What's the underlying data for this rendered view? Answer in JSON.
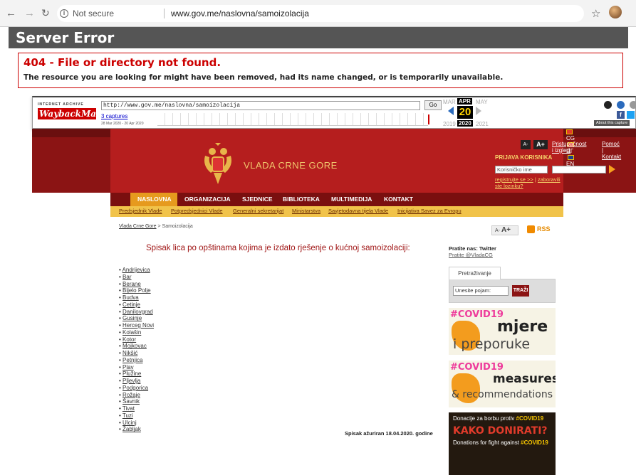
{
  "browser": {
    "security_label": "Not secure",
    "url": "www.gov.me/naslovna/samoizolacija"
  },
  "server_error": {
    "title": "Server Error",
    "heading": "404 - File or directory not found.",
    "message": "The resource you are looking for might have been removed, had its name changed, or is temporarily unavailable."
  },
  "wayback": {
    "logo_top": "INTERNET ARCHIVE",
    "logo_main": "WaybackMachine",
    "url": "http://www.gov.me/naslovna/samoizolacija",
    "go_label": "Go",
    "captures": "3 captures",
    "range": "28 Mar 2020 - 20 Apr 2020",
    "month_prev": "MAR",
    "month_current": "APR",
    "month_next": "MAY",
    "day": "20",
    "year_prev": "2019",
    "year_current": "2020",
    "year_next": "2021",
    "about": "About this capture"
  },
  "site": {
    "languages": [
      "CG",
      "ЦГ",
      "EN"
    ],
    "title": "VLADA CRNE GORE",
    "size_small": "A-",
    "size_large": "A+",
    "header_links": [
      "Pristupačnost i izgled",
      "Pomoć | Kontakt"
    ],
    "login": {
      "label": "PRIJAVA KORISNIKA",
      "username_placeholder": "Korisničko ime",
      "register": "registrujte se >>",
      "separator": "|",
      "forgot": "zaboravili ste lozinku?"
    },
    "nav": [
      "NASLOVNA",
      "ORGANIZACIJA",
      "SJEDNICE",
      "BIBLIOTEKA",
      "MULTIMEDIJA",
      "KONTAKT"
    ],
    "subnav": [
      "Predsjednik Vlade",
      "Potpredsjednici Vlade",
      "Generalni sekretarijat",
      "Ministarstva",
      "Savjetodavna tijela Vlade",
      "Inicijativa Savez za Evropu"
    ]
  },
  "content": {
    "breadcrumb_link": "Vlada Crne Gore",
    "breadcrumb_sep": ">",
    "breadcrumb_current": "Samoizolacija",
    "text_small": "A-",
    "text_large": "A+",
    "rss": "RSS",
    "heading": "Spisak lica po opštinama kojima je izdato rješenje o kućnoj samoizolaciji:",
    "towns": [
      "Andrijevica",
      "Bar",
      "Berane",
      "Bijelo Polje",
      "Budva",
      "Cetinje",
      "Danilovgrad",
      "Gusinje",
      "Herceg Novi",
      "Kolašin",
      "Kotor",
      "Mojkovac",
      "Nikšić",
      "Petnjica",
      "Plav",
      "Plužine",
      "Pljevlja",
      "Podgorica",
      "Rožaje",
      "Šavnik",
      "Tivat",
      "Tuzi",
      "Ulcinj",
      "Žabljak"
    ],
    "updated": "Spisak ažuriran 18.04.2020. godine"
  },
  "sidebar": {
    "follow": "Pratite nas: Twitter",
    "follow_handle": "Pratite @VladaCG",
    "search_tab": "Pretraživanje",
    "search_placeholder": "Unesite pojam:",
    "search_button": "TRAŽI",
    "banner1": {
      "tag": "#COVID19",
      "big": "mjere",
      "small": "i preporuke"
    },
    "banner2": {
      "tag": "#COVID19",
      "big": "measures",
      "small": "& recommendations"
    },
    "banner3": {
      "line1": "Donacije za borbu protiv ",
      "line1_tag": "#COVID19",
      "line2": "KAKO DONIRATI?",
      "line3": "Donations for fight against ",
      "line3_tag": "#COVID19"
    }
  },
  "colors": {
    "header_red": "#b51e1e",
    "nav_active": "#e69a1e",
    "subnav": "#f1c34a",
    "error_red": "#cc0000"
  }
}
